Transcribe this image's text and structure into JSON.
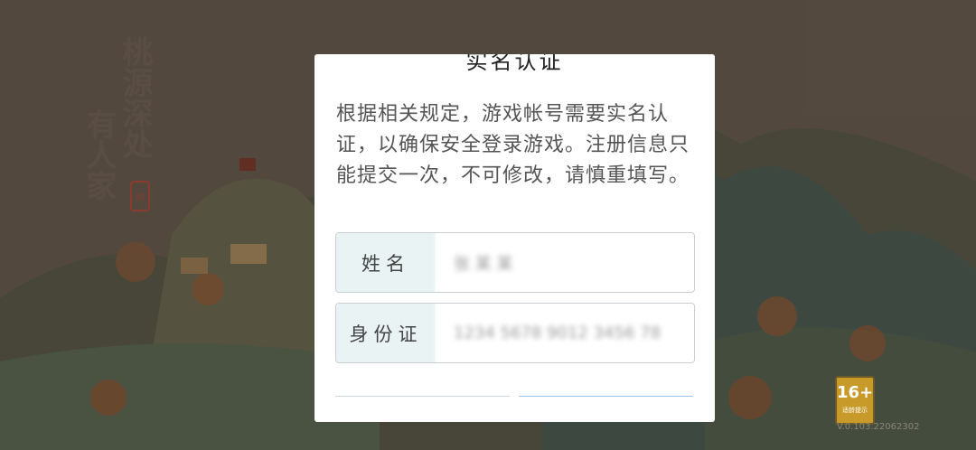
{
  "game": {
    "logo_line1": "桃源深处",
    "logo_line2": "有人家",
    "seal_text": "印",
    "age_rating": "16+",
    "age_hint": "适龄提示",
    "version": "V.0.103.22062302"
  },
  "dialog": {
    "title": "实名认证",
    "description": "根据相关规定，游戏帐号需要实名认证，以确保安全登录游戏。注册信息只能提交一次，不可修改，请慎重填写。",
    "name_label": "姓名",
    "name_value": "张 某 某",
    "id_label": "身份证",
    "id_value": "1234 5678 9012 3456 78"
  },
  "colors": {
    "dialog_bg": "#ffffff",
    "label_bg": "#e9f3f4",
    "border": "#c9ced3"
  }
}
